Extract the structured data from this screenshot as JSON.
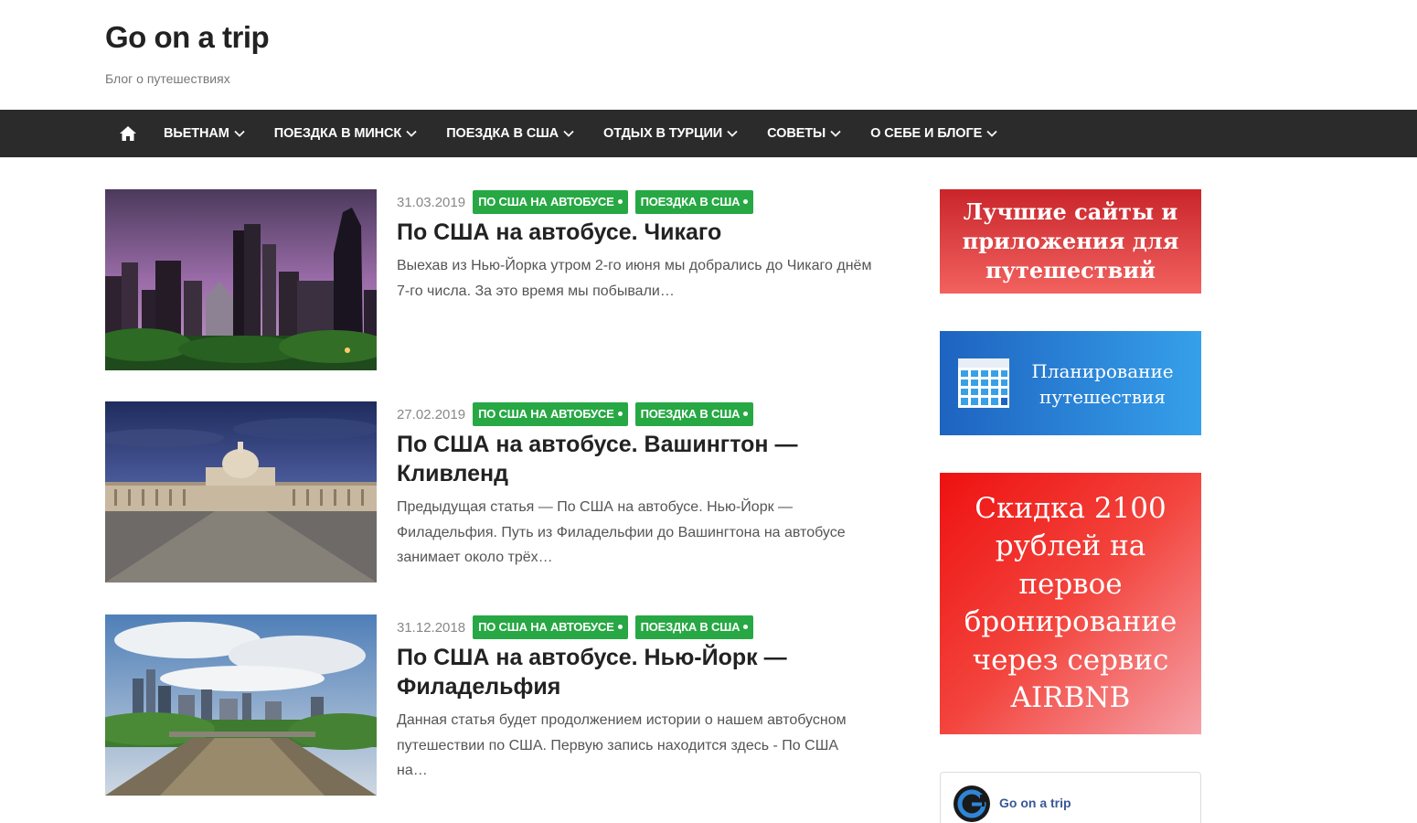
{
  "site": {
    "title": "Go on a trip",
    "tagline": "Блог о путешествиях"
  },
  "nav": {
    "home_icon": "home-icon",
    "items": [
      {
        "label": "ВЬЕТНАМ"
      },
      {
        "label": "ПОЕЗДКА В МИНСК"
      },
      {
        "label": "ПОЕЗДКА В США"
      },
      {
        "label": "ОТДЫХ В ТУРЦИИ"
      },
      {
        "label": "СОВЕТЫ"
      },
      {
        "label": "О СЕБЕ И БЛОГЕ"
      }
    ]
  },
  "posts": [
    {
      "date": "31.03.2019",
      "categories": [
        "ПО США НА АВТОБУСЕ",
        "ПОЕЗДКА В США"
      ],
      "title": "По США на автобусе. Чикаго",
      "excerpt": "Выехав из Нью-Йорка утром 2-го июня мы добрались до Чикаго днём 7-го числа. За это время мы побывали…"
    },
    {
      "date": "27.02.2019",
      "categories": [
        "ПО США НА АВТОБУСЕ",
        "ПОЕЗДКА В США"
      ],
      "title": "По США на автобусе. Вашингтон — Кливленд",
      "excerpt": "Предыдущая статья — По США на автобусе. Нью-Йорк — Филадельфия. Путь из Филадельфии до Вашингтона на автобусе занимает около трёх…"
    },
    {
      "date": "31.12.2018",
      "categories": [
        "ПО США НА АВТОБУСЕ",
        "ПОЕЗДКА В США"
      ],
      "title": "По США на автобусе. Нью-Йорк — Филадельфия",
      "excerpt": "Данная статья будет продолжением истории о нашем автобусном путешествии по США. Первую запись находится здесь -  По США на…"
    }
  ],
  "sidebar": {
    "banner1": "Лучшие сайты и приложения для путешествий",
    "banner2": "Планирование путешествия",
    "banner3": "Скидка 2100 рублей на первое бронирование через сервис AIRBNB",
    "widget_name": "Go on a trip",
    "colors": {
      "badge": "#27a844",
      "nav": "#2b2b2b",
      "banner1": "#d9383a",
      "banner2": "#2a82d8",
      "banner3": "#f0302c"
    }
  }
}
